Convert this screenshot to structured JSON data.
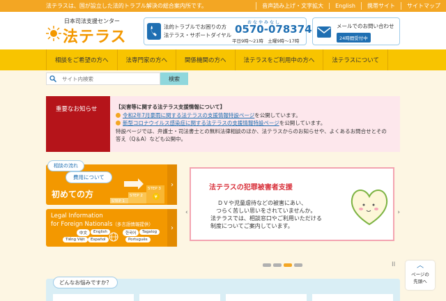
{
  "topbar": {
    "tagline": "法テラスは、国が設立した法的トラブル解決の総合案内所です。",
    "links": [
      "音声読み上げ・文字拡大",
      "English",
      "携帯サイト",
      "サイトマップ"
    ]
  },
  "header": {
    "logo_sub": "日本司法支援センター",
    "logo_main": "法テラス",
    "phone": {
      "line1": "法的トラブルでお困りの方",
      "line2": "法テラス・サポートダイヤル",
      "ruby": "おなやみなし",
      "number": "0570-078374",
      "hours": "平日9時～21時　土曜9時～17時"
    },
    "mail": {
      "label": "メールでのお問い合わせ",
      "badge": "24時間受付中"
    }
  },
  "nav": {
    "items": [
      "相談をご希望の方へ",
      "法専門家の方へ",
      "関係機関の方へ",
      "法テラスをご利用中の方へ",
      "法テラスについて"
    ]
  },
  "search": {
    "placeholder": "サイト内検索",
    "button": "検索"
  },
  "notice": {
    "label": "重要なお知らせ",
    "title": "【災害等に関する法テラス支援情報について】",
    "item1_link": "令和2年7月豪雨に関する法テラスの支援情報特設ページ",
    "item1_suffix": "を公開しています。",
    "item2_link": "新型コロナウイルス感染症に関する法テラスの支援情報特設ページ",
    "item2_suffix": "を公開しています。",
    "body1": "特設ページでは、弁護士・司法書士との無料法律相談のほか、法テラスからのお知らせや、よくあるお問合せとその",
    "body2": "答え（Q＆A）なども公開中。"
  },
  "firsttime": {
    "bubble1": "相談の流れ",
    "bubble2": "費用について",
    "title": "初めての方",
    "step1": "STEP 1",
    "step2": "STEP 2",
    "step3": "STEP 3",
    "yen": "¥",
    "arrow": "›"
  },
  "foreign": {
    "title1": "Legal Information",
    "title2": "for Foreign Nationals",
    "title2_note": "（多言語情報提供）",
    "langs": [
      "中文",
      "English",
      "한국어",
      "Tagalog",
      "Tiếng Việt",
      "Español",
      "Português"
    ],
    "arrow": "›"
  },
  "banner": {
    "title": "法テラスの犯罪被害者支援",
    "lines": [
      "ＤＶや児童虐待などの被害にあい、",
      "つらく苦しい思いをされていませんか。",
      "法テラスでは、相談窓口やご利用いただける",
      "制度についてご案内しています。"
    ],
    "prev": "‹",
    "next": "›"
  },
  "slider": {
    "active_index": 2,
    "count": 4,
    "pause": "II"
  },
  "totop": {
    "chevron": "︿",
    "line1": "ページの",
    "line2": "先頭へ"
  },
  "worries": {
    "title": "どんなお悩みですか？"
  },
  "colors": {
    "orange": "#f39800",
    "yellow": "#f8c400",
    "blue": "#1f6fb2",
    "red": "#b5141a"
  }
}
